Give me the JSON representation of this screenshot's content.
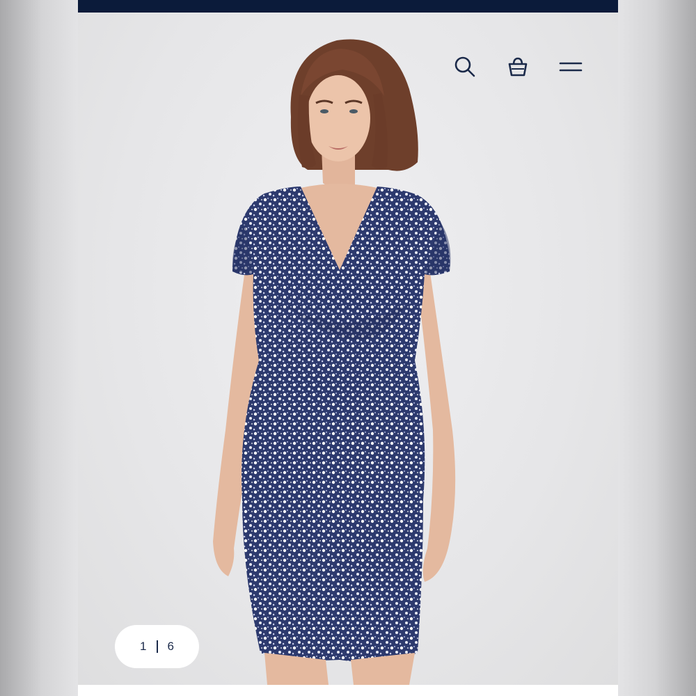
{
  "header": {
    "icons": [
      "search-icon",
      "shopping-bag-icon",
      "menu-icon"
    ],
    "icon_color": "#1b2a4a",
    "bar_color": "#0b1b3a"
  },
  "gallery": {
    "current": "1",
    "total": "6"
  }
}
